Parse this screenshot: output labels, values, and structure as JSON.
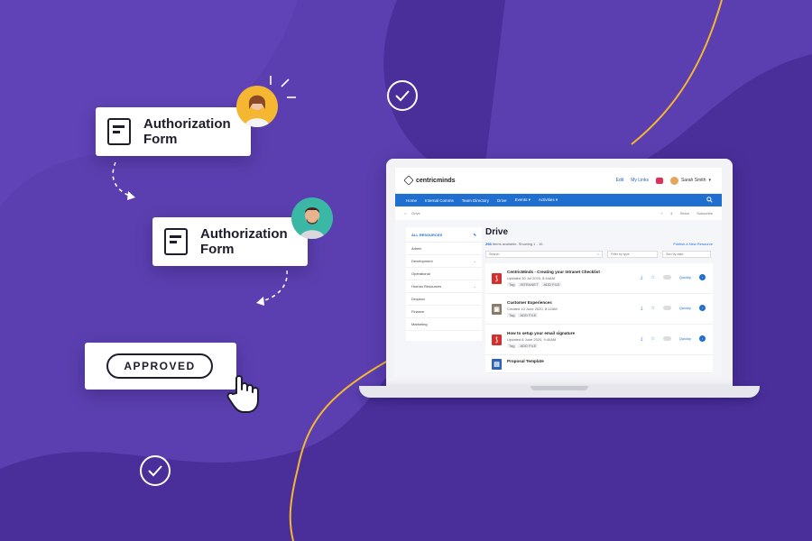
{
  "cards": {
    "form1": "Authorization Form",
    "form2": "Authorization Form",
    "approved": "APPROVED"
  },
  "app": {
    "brand": "centricminds",
    "top_actions": [
      "Edit",
      "My Links"
    ],
    "user": "Sarah Smith",
    "nav": [
      "Home",
      "Internal Comms",
      "Team Directory",
      "Drive",
      "Events ▾",
      "Activities ▾"
    ],
    "breadcrumb": "Drive",
    "crumb_actions": [
      "4",
      "Share",
      "Subscribe"
    ],
    "sidebar": {
      "all": "ALL RESOURCES",
      "items": [
        "Admin",
        "Development",
        "Operational",
        "Human Resources",
        "Dropbox",
        "Finance",
        "Marketing"
      ]
    },
    "drive": {
      "title": "Drive",
      "count_num": "298",
      "count_text": "Items available. Showing 1 - 10.",
      "publish": "Publish a New Resource",
      "search_placeholder": "Search",
      "filter_type": "Filter by type",
      "sort": "Sort by date"
    },
    "rows": [
      {
        "title": "CentricMinds - Creating your Intranet Checklist",
        "meta": "Updated 30 Jul 2020, 8:44AM",
        "tags": [
          "Tag",
          "INTRANET",
          "ADD FILE"
        ],
        "icon": "pdf-icon",
        "action": "Quickly"
      },
      {
        "title": "Customer Experiences",
        "meta": "Created 10 June 2020, 8:12AM",
        "tags": [
          "Tag",
          "ADD FILE"
        ],
        "icon": "image-icon",
        "action": "Quickly"
      },
      {
        "title": "How to setup your email signature",
        "meta": "Updated 8 June 2020, 9:40AM",
        "tags": [
          "Tag",
          "ADD FILE"
        ],
        "icon": "pdf-icon",
        "action": "Quickly"
      },
      {
        "title": "Proposal Template",
        "meta": "",
        "tags": [],
        "icon": "presentation-icon",
        "action": ""
      }
    ]
  },
  "colors": {
    "background": "#5b3fb0",
    "accent_blue": "#1f6fd1",
    "accent_yellow": "#f5b731"
  }
}
